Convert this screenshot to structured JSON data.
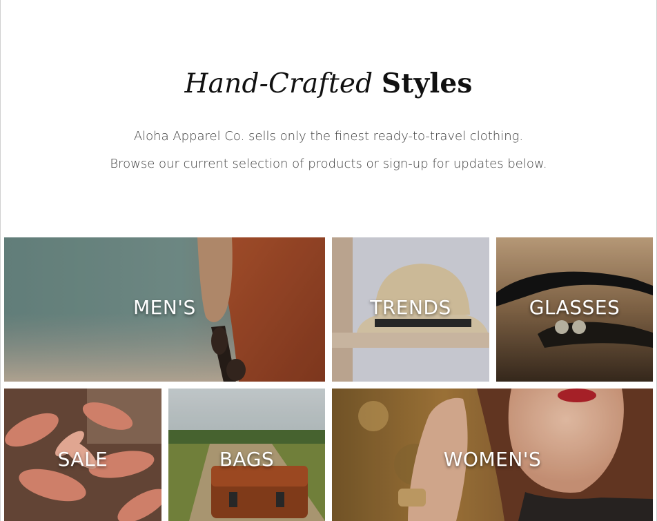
{
  "hero": {
    "title_italic": "Hand-Crafted",
    "title_bold": "Styles",
    "intro_line1": "Aloha Apparel Co. sells only the finest ready-to-travel clothing.",
    "intro_line2": "Browse our current selection of products or sign-up for updates below."
  },
  "categories": [
    {
      "label": "MEN'S"
    },
    {
      "label": "TRENDS"
    },
    {
      "label": "GLASSES"
    },
    {
      "label": "SALE"
    },
    {
      "label": "BAGS"
    },
    {
      "label": "WOMEN'S"
    }
  ],
  "colors": {
    "text_dark": "#111111",
    "text_body": "#3d3d3d",
    "tile_label": "#ffffff"
  }
}
